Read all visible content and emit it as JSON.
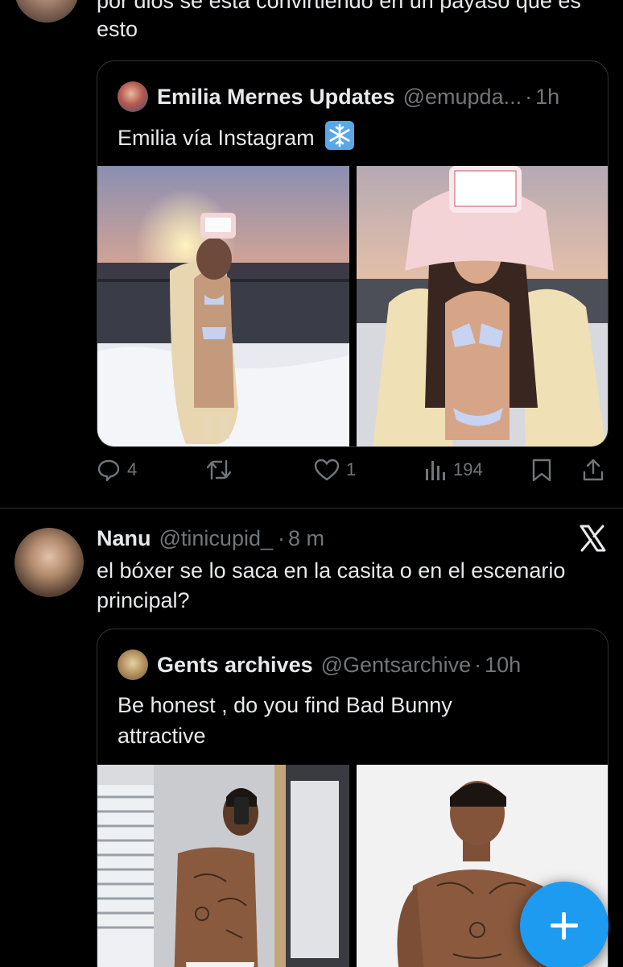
{
  "tweet1": {
    "text": "por dios se está convirtiendo en un payaso que es esto",
    "quote": {
      "name": "Emilia Mernes Updates",
      "handle": "@emupda...",
      "dot": "·",
      "time": "1h",
      "text": "Emilia vía Instagram",
      "emoji": "❄️"
    },
    "actions": {
      "replies": "4",
      "retweets": "",
      "likes": "1",
      "views": "194"
    }
  },
  "tweet2": {
    "name": "Nanu",
    "handle": "@tinicupid_",
    "dot": "·",
    "time": "8 m",
    "text": "el bóxer se lo saca en la casita o en el escenario principal?",
    "quote": {
      "name": "Gents archives",
      "handle": "@Gentsarchive",
      "dot": "·",
      "time": "10h",
      "text": "Be honest , do you find Bad Bunny attractive"
    }
  },
  "colors": {
    "accent": "#1d9bf0",
    "muted": "#71767b",
    "text": "#e7e9ea",
    "border": "#2f3336",
    "background": "#000000"
  },
  "icons": [
    "reply-icon",
    "retweet-icon",
    "like-icon",
    "views-icon",
    "bookmark-icon",
    "share-icon",
    "x-logo-icon",
    "compose-plus-icon"
  ]
}
